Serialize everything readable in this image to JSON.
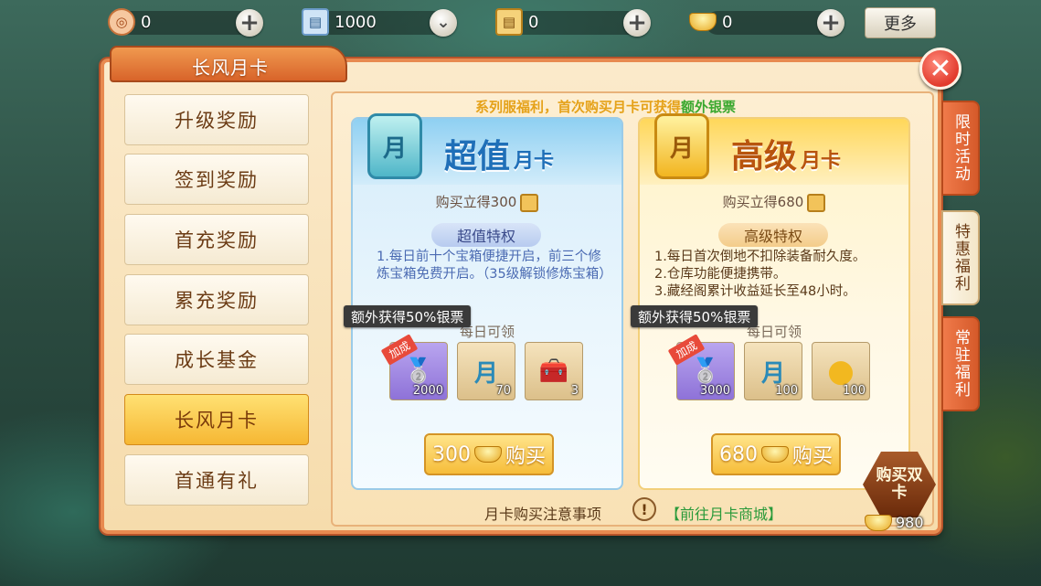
{
  "topbar": {
    "resources": [
      {
        "icon": "coupon-icon",
        "value": "0"
      },
      {
        "icon": "scroll-ticket-icon",
        "value": "1000"
      },
      {
        "icon": "gold-scroll-icon",
        "value": "0"
      },
      {
        "icon": "silver-ingot-icon",
        "value": "0"
      }
    ],
    "more_label": "更多"
  },
  "panel": {
    "title": "长风月卡"
  },
  "menu": [
    {
      "label": "升级奖励",
      "active": false
    },
    {
      "label": "签到奖励",
      "active": false
    },
    {
      "label": "首充奖励",
      "active": false
    },
    {
      "label": "累充奖励",
      "active": false
    },
    {
      "label": "成长基金",
      "active": false
    },
    {
      "label": "长风月卡",
      "active": true
    },
    {
      "label": "首通有礼",
      "active": false
    }
  ],
  "notice": {
    "prefix": "系列服福利，首次购买月卡可获得",
    "highlight": "额外银票"
  },
  "cards": [
    {
      "emblem": "月",
      "title": "超值",
      "title_suffix": "月卡",
      "gain": "购买立得300",
      "privilege_title": "超值特权",
      "desc": "1.每日前十个宝箱便捷开启，前三个修炼宝箱免费开启。（35级解锁修炼宝箱）",
      "badge": "额外获得50%银票",
      "daily": "每日可领",
      "items": [
        {
          "icon": "silver-ingot-icon",
          "glyph": "🥈",
          "count": "2000",
          "style": "purple",
          "tag": "加成"
        },
        {
          "icon": "month-token-icon",
          "glyph": "月",
          "count": "70",
          "style": "gold",
          "tag": ""
        },
        {
          "icon": "treasure-chest-icon",
          "glyph": "🧰",
          "count": "3",
          "style": "gold",
          "tag": ""
        }
      ],
      "buy_price": "300",
      "buy_label": "购买"
    },
    {
      "emblem": "月",
      "title": "高级",
      "title_suffix": "月卡",
      "gain": "购买立得680",
      "privilege_title": "高级特权",
      "desc": "1.每日首次倒地不扣除装备耐久度。\n2.仓库功能便捷携带。\n3.藏经阁累计收益延长至48小时。",
      "badge": "额外获得50%银票",
      "daily": "每日可领",
      "items": [
        {
          "icon": "silver-ingot-icon",
          "glyph": "🥈",
          "count": "3000",
          "style": "purple",
          "tag": "加成"
        },
        {
          "icon": "month-token-icon",
          "glyph": "月",
          "count": "100",
          "style": "gold",
          "tag": ""
        },
        {
          "icon": "gold-orb-icon",
          "glyph": "●",
          "count": "100",
          "style": "gold",
          "tag": ""
        }
      ],
      "buy_price": "680",
      "buy_label": "购买"
    }
  ],
  "footer": {
    "note": "月卡购买注意事项",
    "warn": "!",
    "link": "【前往月卡商城】"
  },
  "side_tabs": [
    {
      "label": "限时活动",
      "active": false
    },
    {
      "label": "特惠福利",
      "active": true
    },
    {
      "label": "常驻福利",
      "active": false
    }
  ],
  "double_card": {
    "label": "购买双卡",
    "price": "980"
  }
}
